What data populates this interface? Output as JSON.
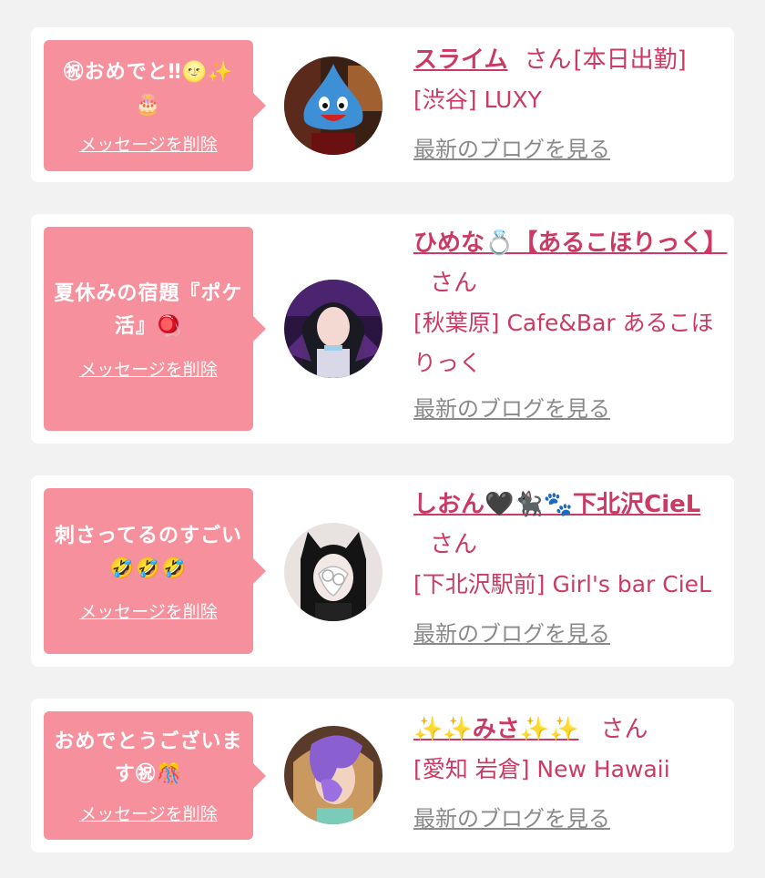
{
  "cards": [
    {
      "message": "㊗おめでと‼🌝✨🎂",
      "delete_label": "メッセージを削除",
      "name": "スライム",
      "suffix": "さん",
      "status": "[本日出勤]",
      "location": "[渋谷] LUXY",
      "blog_label": "最新のブログを見る",
      "avatar_icon": "slime-photo"
    },
    {
      "message": "夏休みの宿題『ポケ活』🪀",
      "delete_label": "メッセージを削除",
      "name": "ひめな💍【あるこほりっく】",
      "suffix": "さん",
      "status": "",
      "location": "[秋葉原] Cafe&Bar あるこほりっく",
      "blog_label": "最新のブログを見る",
      "avatar_icon": "girl-photo"
    },
    {
      "message": "刺さってるのすごい🤣🤣🤣",
      "delete_label": "メッセージを削除",
      "name": "しおん🖤🐈‍⬛🐾下北沢CieL",
      "suffix": "さん",
      "status": "",
      "location": "[下北沢駅前] Girl's bar CieL",
      "blog_label": "最新のブログを見る",
      "avatar_icon": "catgirl-photo"
    },
    {
      "message": "おめでとうございます㊗🎊",
      "delete_label": "メッセージを削除",
      "name": "✨✨みさ✨✨",
      "suffix": "さん",
      "status": "",
      "location": "[愛知 岩倉] New Hawaii",
      "blog_label": "最新のブログを見る",
      "avatar_icon": "purple-hair-photo"
    }
  ]
}
